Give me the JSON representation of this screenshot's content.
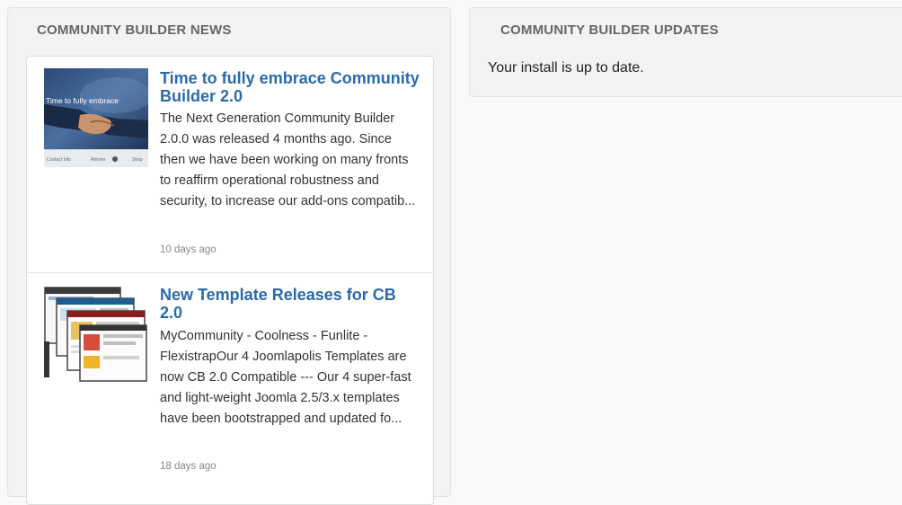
{
  "news": {
    "title": "COMMUNITY BUILDER NEWS",
    "items": [
      {
        "title": "Time to fully embrace Community Builder 2.0",
        "excerpt": "The Next Generation Community Builder 2.0.0 was released 4 months ago. Since then we have been working on many fronts to reaffirm operational robustness and security, to increase our add-ons compatib...",
        "date": "10 days ago",
        "thumb_caption": "Time to fully embrace",
        "thumb_tabs": [
          "Contact Info",
          "Articles",
          "Shop"
        ]
      },
      {
        "title": "New Template Releases for CB 2.0",
        "excerpt": "MyCommunity - Coolness - Funlite - FlexistrapOur 4 Joomlapolis Templates are now CB 2.0 Compatible --- Our 4 super-fast and light-weight Joomla 2.5/3.x templates have been bootstrapped and updated fo...",
        "date": "18 days ago"
      }
    ]
  },
  "updates": {
    "title": "COMMUNITY BUILDER UPDATES",
    "message": "Your install is up to date."
  }
}
